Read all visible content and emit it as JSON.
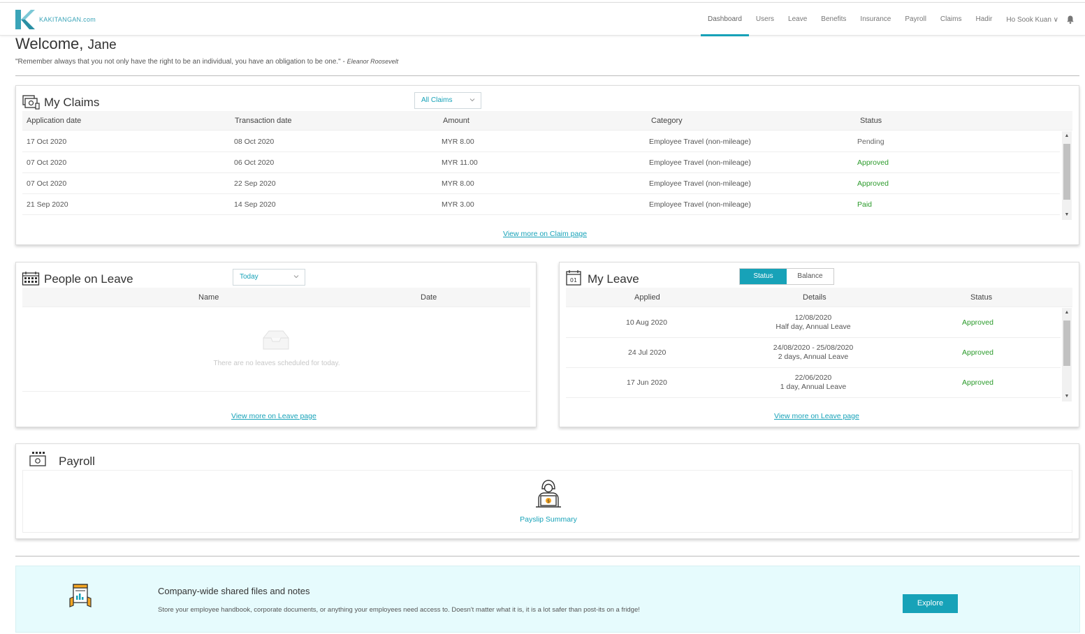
{
  "brand": {
    "name": "KAKITANGAN.com",
    "accent": "#17a2b8"
  },
  "nav": {
    "items": [
      "Dashboard",
      "Users",
      "Leave",
      "Benefits",
      "Insurance",
      "Payroll",
      "Claims",
      "Hadir"
    ],
    "active": "Dashboard",
    "user": "Ho Sook Kuan",
    "bell_icon": "bell-icon"
  },
  "welcome": {
    "greeting": "Welcome,",
    "name": "Jane"
  },
  "quote": {
    "text": "\"Remember always that you not only have the right to be an individual, you have an obligation to be one.\" -",
    "author": "Eleanor Roosevelt"
  },
  "claims": {
    "title": "My Claims",
    "filter": "All Claims",
    "headers": [
      "Application date",
      "Transaction date",
      "Amount",
      "Category",
      "Status"
    ],
    "rows": [
      [
        "17 Oct 2020",
        "08 Oct 2020",
        "MYR 8.00",
        "Employee Travel (non-mileage)",
        "Pending"
      ],
      [
        "07 Oct 2020",
        "06 Oct 2020",
        "MYR 11.00",
        "Employee Travel (non-mileage)",
        "Approved"
      ],
      [
        "07 Oct 2020",
        "22 Sep 2020",
        "MYR 8.00",
        "Employee Travel (non-mileage)",
        "Approved"
      ],
      [
        "21 Sep 2020",
        "14 Sep 2020",
        "MYR 3.00",
        "Employee Travel (non-mileage)",
        "Paid"
      ]
    ],
    "link": "View more on Claim page"
  },
  "people_on_leave": {
    "title": "People on Leave",
    "filter": "Today",
    "headers": [
      "Name",
      "Date"
    ],
    "empty": "There are no leaves scheduled for today.",
    "link": "View more on Leave page"
  },
  "my_leave": {
    "title": "My Leave",
    "tabs": [
      "Status",
      "Balance"
    ],
    "active_tab": "Status",
    "headers": [
      "Applied",
      "Details",
      "Status"
    ],
    "rows": [
      {
        "applied": "10 Aug 2020",
        "date": "12/08/2020",
        "desc": "Half day, Annual Leave",
        "status": "Approved"
      },
      {
        "applied": "24 Jul 2020",
        "date": "24/08/2020 - 25/08/2020",
        "desc": "2 days, Annual Leave",
        "status": "Approved"
      },
      {
        "applied": "17 Jun 2020",
        "date": "22/06/2020",
        "desc": "1 day, Annual Leave",
        "status": "Approved"
      }
    ],
    "link": "View more on Leave page"
  },
  "payroll": {
    "title": "Payroll",
    "item": "Payslip Summary"
  },
  "banner": {
    "title": "Company-wide shared files and notes",
    "desc": "Store your employee handbook, corporate documents, or anything your employees need access to. Doesn't matter what it is, it is a lot safer than post-its on a fridge!",
    "button": "Explore"
  }
}
